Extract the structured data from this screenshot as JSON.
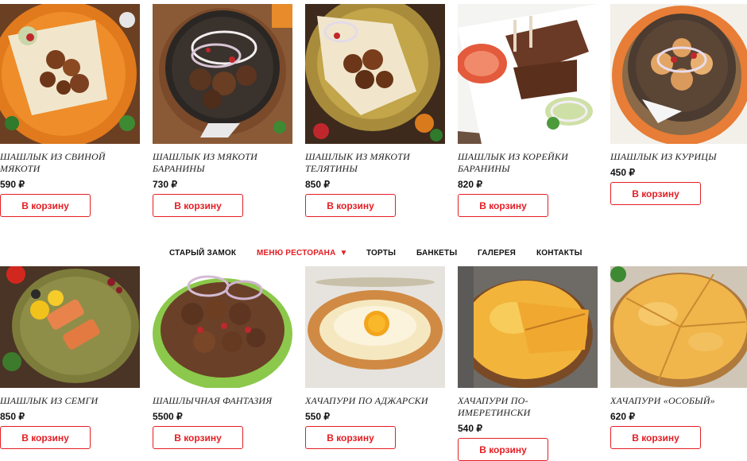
{
  "nav": {
    "items": [
      "СТАРЫЙ ЗАМОК",
      "МЕНЮ РЕСТОРАНА",
      "ТОРТЫ",
      "БАНКЕТЫ",
      "ГАЛЕРЕЯ",
      "КОНТАКТЫ"
    ],
    "dropdown_icon": "▼"
  },
  "button_label": "В корзину",
  "colors": {
    "accent": "#e31e24"
  },
  "products": [
    {
      "title": "ШАШЛЫК ИЗ СВИНОЙ МЯКОТИ",
      "price": "590 ₽"
    },
    {
      "title": "ШАШЛЫК ИЗ МЯКОТИ БАРАНИНЫ",
      "price": "730 ₽"
    },
    {
      "title": "ШАШЛЫК ИЗ МЯКОТИ ТЕЛЯТИНЫ",
      "price": "850 ₽"
    },
    {
      "title": "ШАШЛЫК ИЗ КОРЕЙКИ БАРАНИНЫ",
      "price": "820 ₽"
    },
    {
      "title": "ШАШЛЫК ИЗ КУРИЦЫ",
      "price": "450 ₽"
    },
    {
      "title": "ШАШЛЫК ИЗ СЕМГИ",
      "price": "850 ₽"
    },
    {
      "title": "ШАШЛЫЧНАЯ ФАНТАЗИЯ",
      "price": "5500 ₽"
    },
    {
      "title": "ХАЧАПУРИ ПО АДЖАРСКИ",
      "price": "550 ₽"
    },
    {
      "title": "ХАЧАПУРИ ПО-ИМЕРЕТИНСКИ",
      "price": "540 ₽"
    },
    {
      "title": "ХАЧАПУРИ «ОСОБЫЙ»",
      "price": "620 ₽"
    }
  ]
}
